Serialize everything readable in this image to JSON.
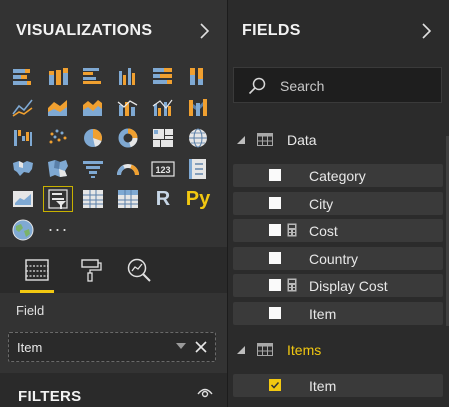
{
  "visualizations": {
    "title": "VISUALIZATIONS",
    "icons": [
      "stacked-bar-chart-icon",
      "stacked-column-chart-icon",
      "clustered-bar-chart-icon",
      "clustered-column-chart-icon",
      "100-percent-stacked-bar-chart-icon",
      "100-percent-stacked-column-chart-icon",
      "line-chart-icon",
      "area-chart-icon",
      "stacked-area-chart-icon",
      "line-and-stacked-column-chart-icon",
      "line-and-clustered-column-chart-icon",
      "ribbon-chart-icon",
      "waterfall-chart-icon",
      "scatter-chart-icon",
      "pie-chart-icon",
      "donut-chart-icon",
      "treemap-icon",
      "map-icon",
      "filled-map-icon",
      "shape-map-icon",
      "funnel-icon",
      "gauge-icon",
      "card-icon",
      "multi-row-card-icon",
      "kpi-icon",
      "slicer-icon",
      "table-icon",
      "matrix-icon",
      "r-script-visual-icon",
      "python-visual-icon",
      "arcgis-map-icon",
      "more-visuals-icon"
    ],
    "selected_index": 25,
    "r_label": "R",
    "py_label": "Py",
    "more_label": "···"
  },
  "tabs": [
    "fields-tab-icon",
    "format-paint-roller-icon",
    "analytics-magnifier-icon"
  ],
  "field_well": {
    "label": "Field",
    "value": "Item"
  },
  "filters": {
    "title": "FILTERS"
  },
  "fields": {
    "title": "FIELDS",
    "search_placeholder": "Search",
    "tables": [
      {
        "name": "Data",
        "highlighted": false,
        "fields": [
          {
            "name": "Category",
            "checked": false,
            "calculated": false
          },
          {
            "name": "City",
            "checked": false,
            "calculated": false
          },
          {
            "name": "Cost",
            "checked": false,
            "calculated": true
          },
          {
            "name": "Country",
            "checked": false,
            "calculated": false
          },
          {
            "name": "Display Cost",
            "checked": false,
            "calculated": true
          },
          {
            "name": "Item",
            "checked": false,
            "calculated": false
          }
        ]
      },
      {
        "name": "Items",
        "highlighted": true,
        "fields": [
          {
            "name": "Item",
            "checked": true,
            "calculated": false
          }
        ]
      }
    ]
  },
  "colors": {
    "accent": "#f2c811",
    "chart_blue": "#7fa9d3",
    "chart_orange": "#f0a030",
    "chart_dark": "#5a7fa8"
  }
}
